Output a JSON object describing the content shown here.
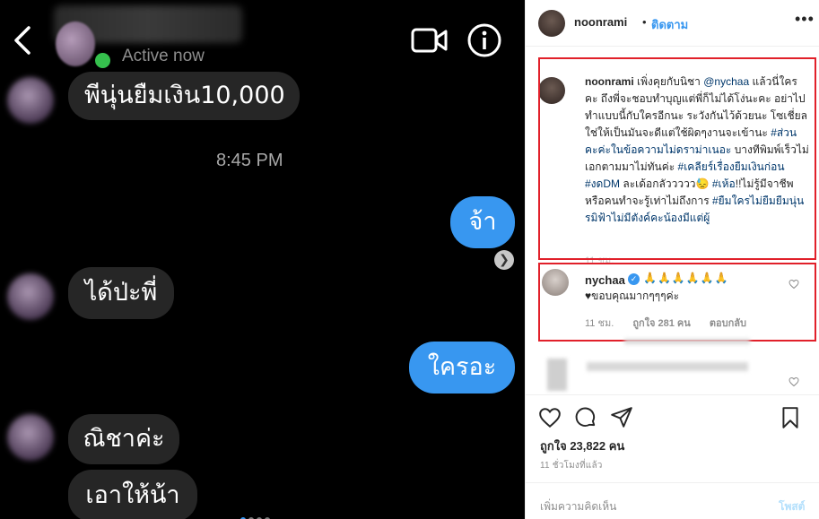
{
  "chat": {
    "status": "Active now",
    "messages": {
      "m1": "พีนุ่นยืมเงิน10,000",
      "time": "8:45 PM",
      "m2": "จ้า",
      "m3": "ได้ป่ะพี่",
      "m4": "ใครอะ",
      "m5": "ณิชาค่ะ",
      "m6": "เอาให้น้า"
    }
  },
  "post": {
    "header": {
      "username": "noonrami",
      "separator": "•",
      "follow": "ติดตาม",
      "more": "•••"
    },
    "caption": {
      "username": "noonrami",
      "p1": " เพิ่งคุยกับนิชา ",
      "mention": "@nychaa",
      "p2": " แล้วนี่ใครคะ ถึงพี่จะชอบทำบุญแต่พี่ก็ไม่ได้โง่นะคะ อย่าไปทำแบบนี้กับใครอีกนะ ระวังกันไว้ด้วยนะ โซเชี่ยลใช่ให้เป็นมันจะดีแต่ใช้ผิดๆงานจะเข้านะ ",
      "h1": "#ส่วนคะค่ะในข้อความไม่ดราม่าเนอะ",
      "p3": " บางทีพิมพ์เร็วไม่เอกตามมาไม่ทันค่ะ ",
      "h2": "#เคลียร์เรื่องยืมเงินก่อน",
      "p4": " ",
      "h3": "#งดDM",
      "p5": " ละเด้อกลัววววว😓 ",
      "h4": "#เห้อ",
      "p6": "!!ไม่รู้มีจาชีพหรือคนทำจะรู้เท่าไม่ถึงการ ",
      "h5": "#ยืมใครไม่ยืมยืมนุ่นรมิฟ้าไม่มีตังค์คะน้องมีแต่ผู้",
      "time": "11 ชม."
    },
    "comment": {
      "username": "nychaa",
      "emojis": "🙏🙏🙏🙏🙏🙏",
      "text": "♥ขอบคุณมากๆๆๆค่ะ",
      "time": "11 ชม.",
      "likes": "ถูกใจ 281 คน",
      "reply": "ตอบกลับ"
    },
    "likes": "ถูกใจ 23,822 คน",
    "posted": "11 ชั่วโมงที่แล้ว",
    "add_comment_placeholder": "เพิ่มความคิดเห็น",
    "post_button": "โพสต์"
  },
  "colors": {
    "outgoing_bubble": "#3897f0",
    "incoming_bubble": "#262626",
    "highlight_box": "#e1202a",
    "link": "#00376b",
    "follow": "#3897f0",
    "active_dot": "#35c04d"
  },
  "icons": [
    "back-arrow-icon",
    "video-call-icon",
    "info-icon",
    "next-arrow-icon",
    "more-options-icon",
    "verified-icon",
    "heart-icon",
    "comment-icon",
    "share-icon",
    "bookmark-icon"
  ]
}
